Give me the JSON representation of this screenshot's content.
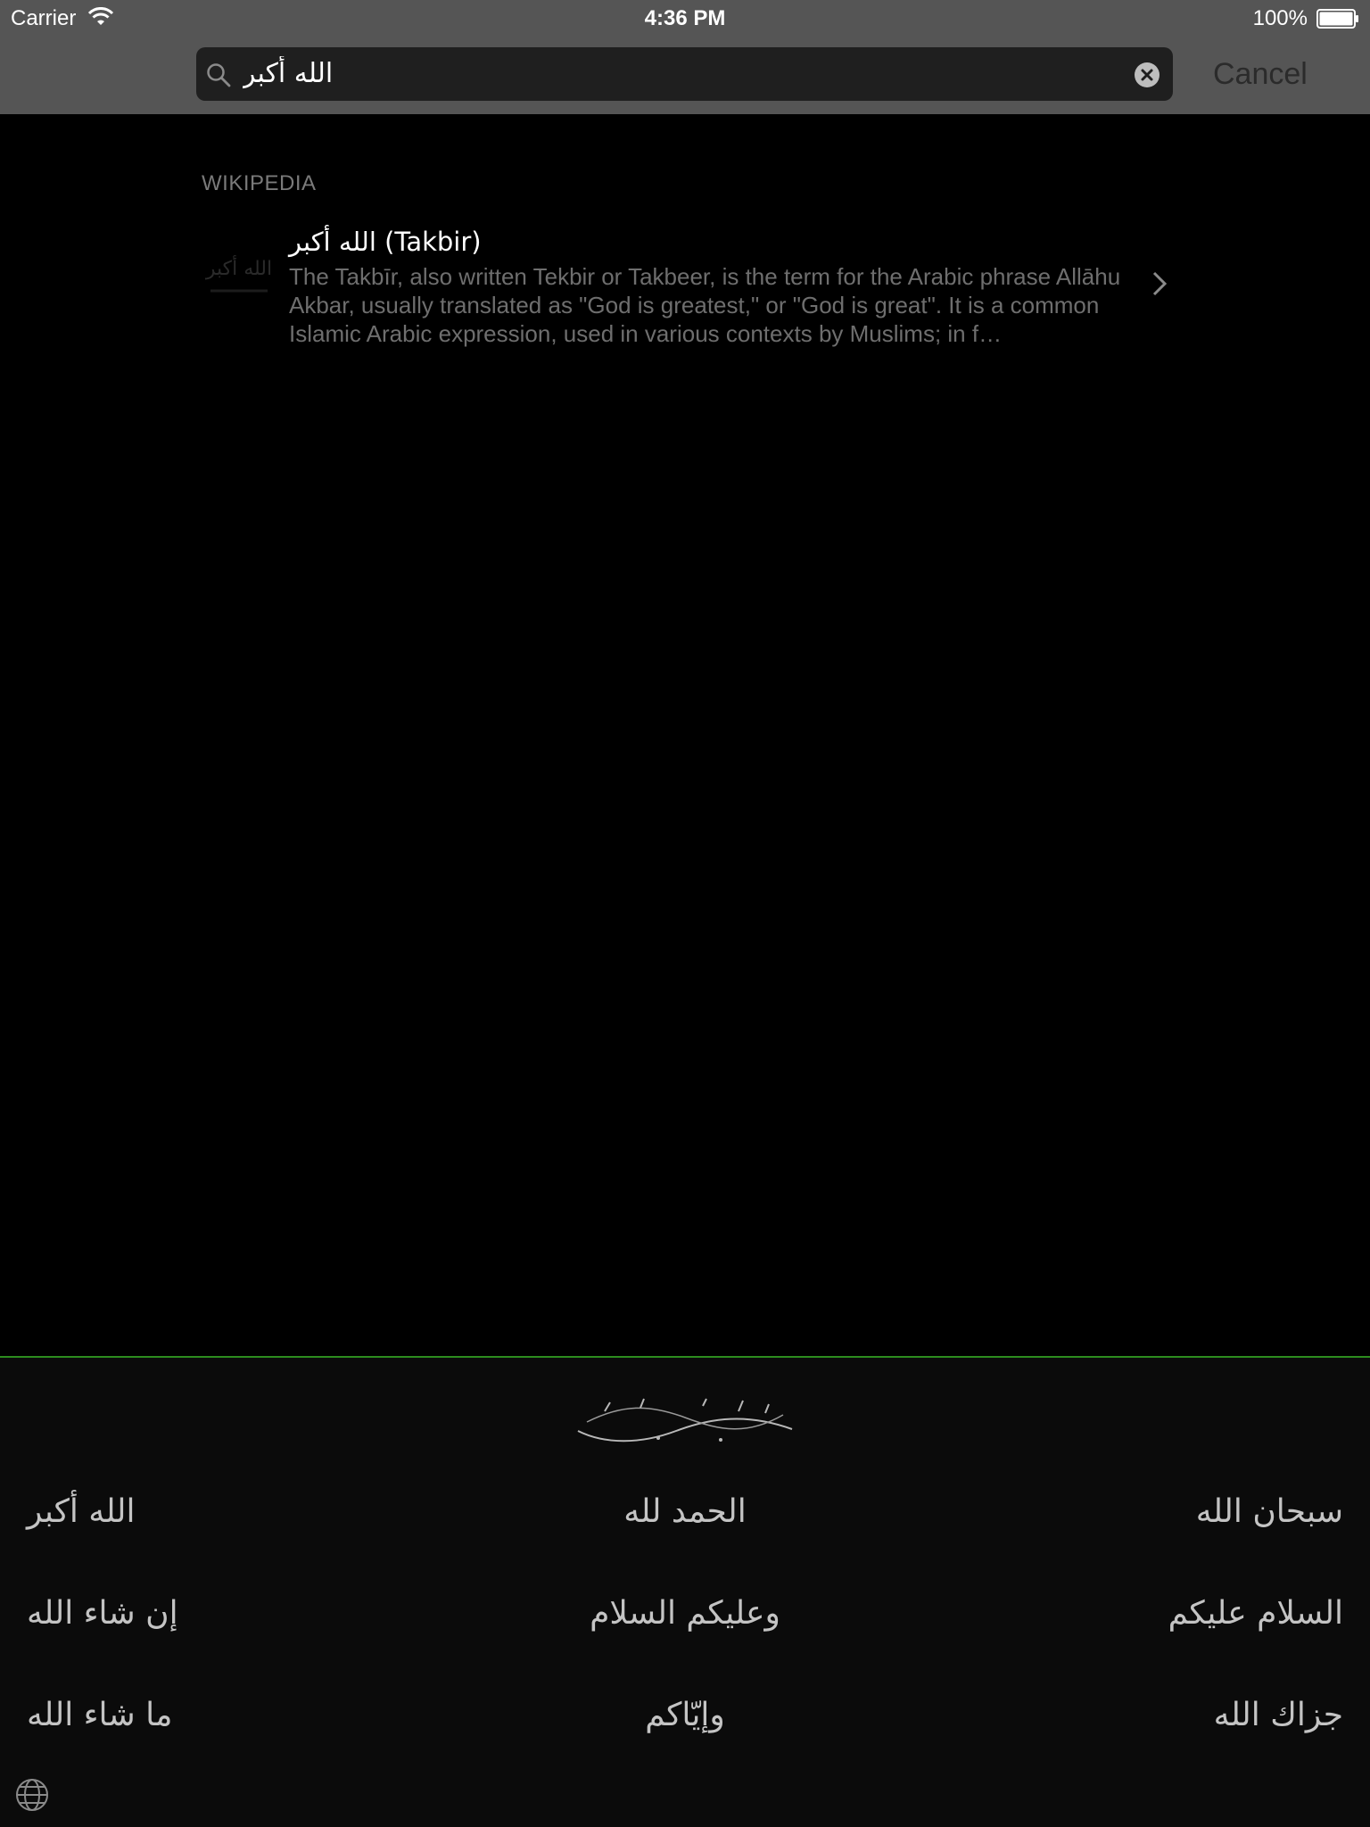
{
  "status_bar": {
    "carrier": "Carrier",
    "time": "4:36 PM",
    "battery": "100%"
  },
  "search": {
    "query": "الله أكبر",
    "cancel_label": "Cancel"
  },
  "results": {
    "section_header": "WIKIPEDIA",
    "items": [
      {
        "title": "الله أكبر (Takbir)",
        "snippet": "The Takbīr, also written Tekbir or Takbeer, is the term for the Arabic phrase Allāhu Akbar, usually translated as \"God is greatest,\" or \"God is great\". It is a common Islamic Arabic expression, used in various contexts by Muslims; in f…"
      }
    ]
  },
  "phrases": {
    "row1": [
      "الله أكبر",
      "الحمد لله",
      "سبحان الله"
    ],
    "row2": [
      "إن شاء الله",
      "وعليكم السلام",
      "السلام عليكم"
    ],
    "row3": [
      "ما شاء الله",
      "وإيّاكم",
      "جزاك الله"
    ]
  },
  "colors": {
    "header_bg": "#555555",
    "panel_divider": "#2c8c1e",
    "panel_bg": "#0b0b0b"
  },
  "icons": {
    "search": "search-icon",
    "clear": "clear-icon",
    "chevron": "chevron-right-icon",
    "globe": "globe-icon",
    "wifi": "wifi-icon",
    "battery": "battery-icon"
  }
}
